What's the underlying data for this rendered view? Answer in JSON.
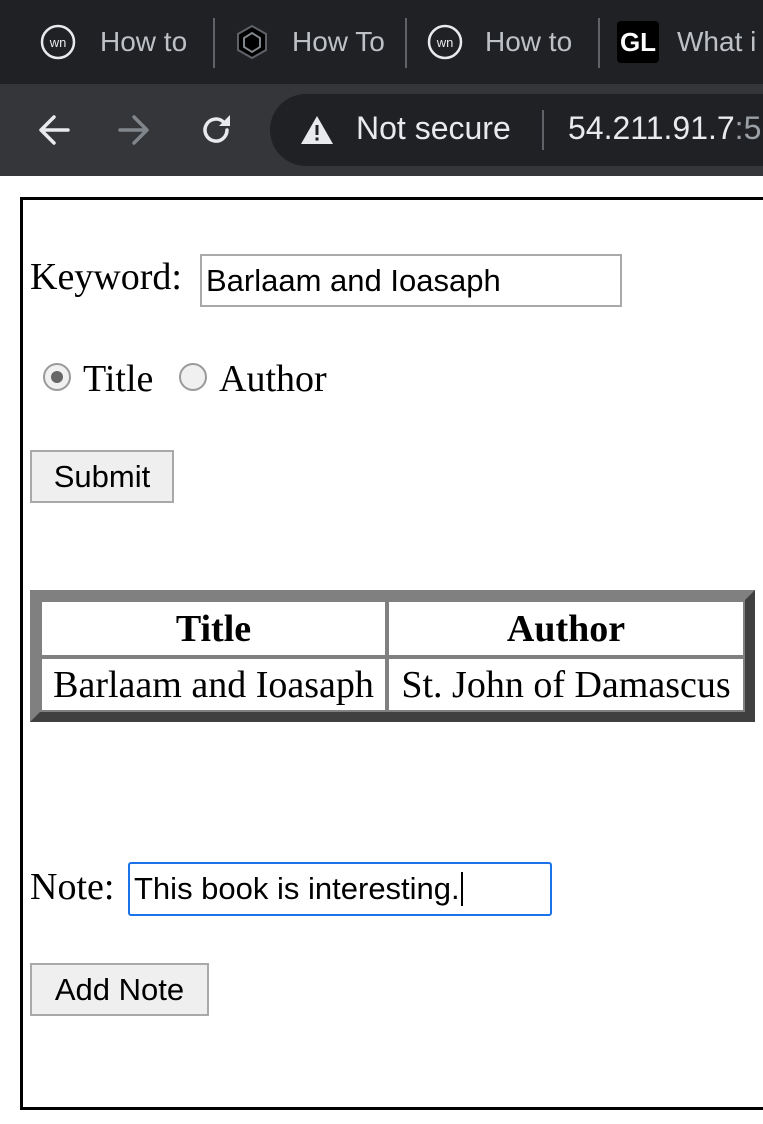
{
  "browser": {
    "tabs": [
      {
        "title": "How to",
        "icon": "webmaster-icon"
      },
      {
        "title": "How To",
        "icon": "hexagon-logo-icon"
      },
      {
        "title": "How to",
        "icon": "webmaster-icon"
      },
      {
        "title": "What i",
        "icon": "gl-logo-icon",
        "icon_text": "GL"
      }
    ],
    "security_label": "Not secure",
    "url": "54.211.91.7",
    "url_port": ":5"
  },
  "form": {
    "keyword_label": "Keyword:",
    "keyword_value": "Barlaam and Ioasaph",
    "radio_title_label": "Title",
    "radio_author_label": "Author",
    "selected_radio": "Title",
    "submit_label": "Submit"
  },
  "results": {
    "headers": [
      "Title",
      "Author"
    ],
    "rows": [
      [
        "Barlaam and Ioasaph",
        "St. John of Damascus"
      ]
    ]
  },
  "note": {
    "label": "Note:",
    "value": "This book is interesting.",
    "add_label": "Add Note"
  }
}
